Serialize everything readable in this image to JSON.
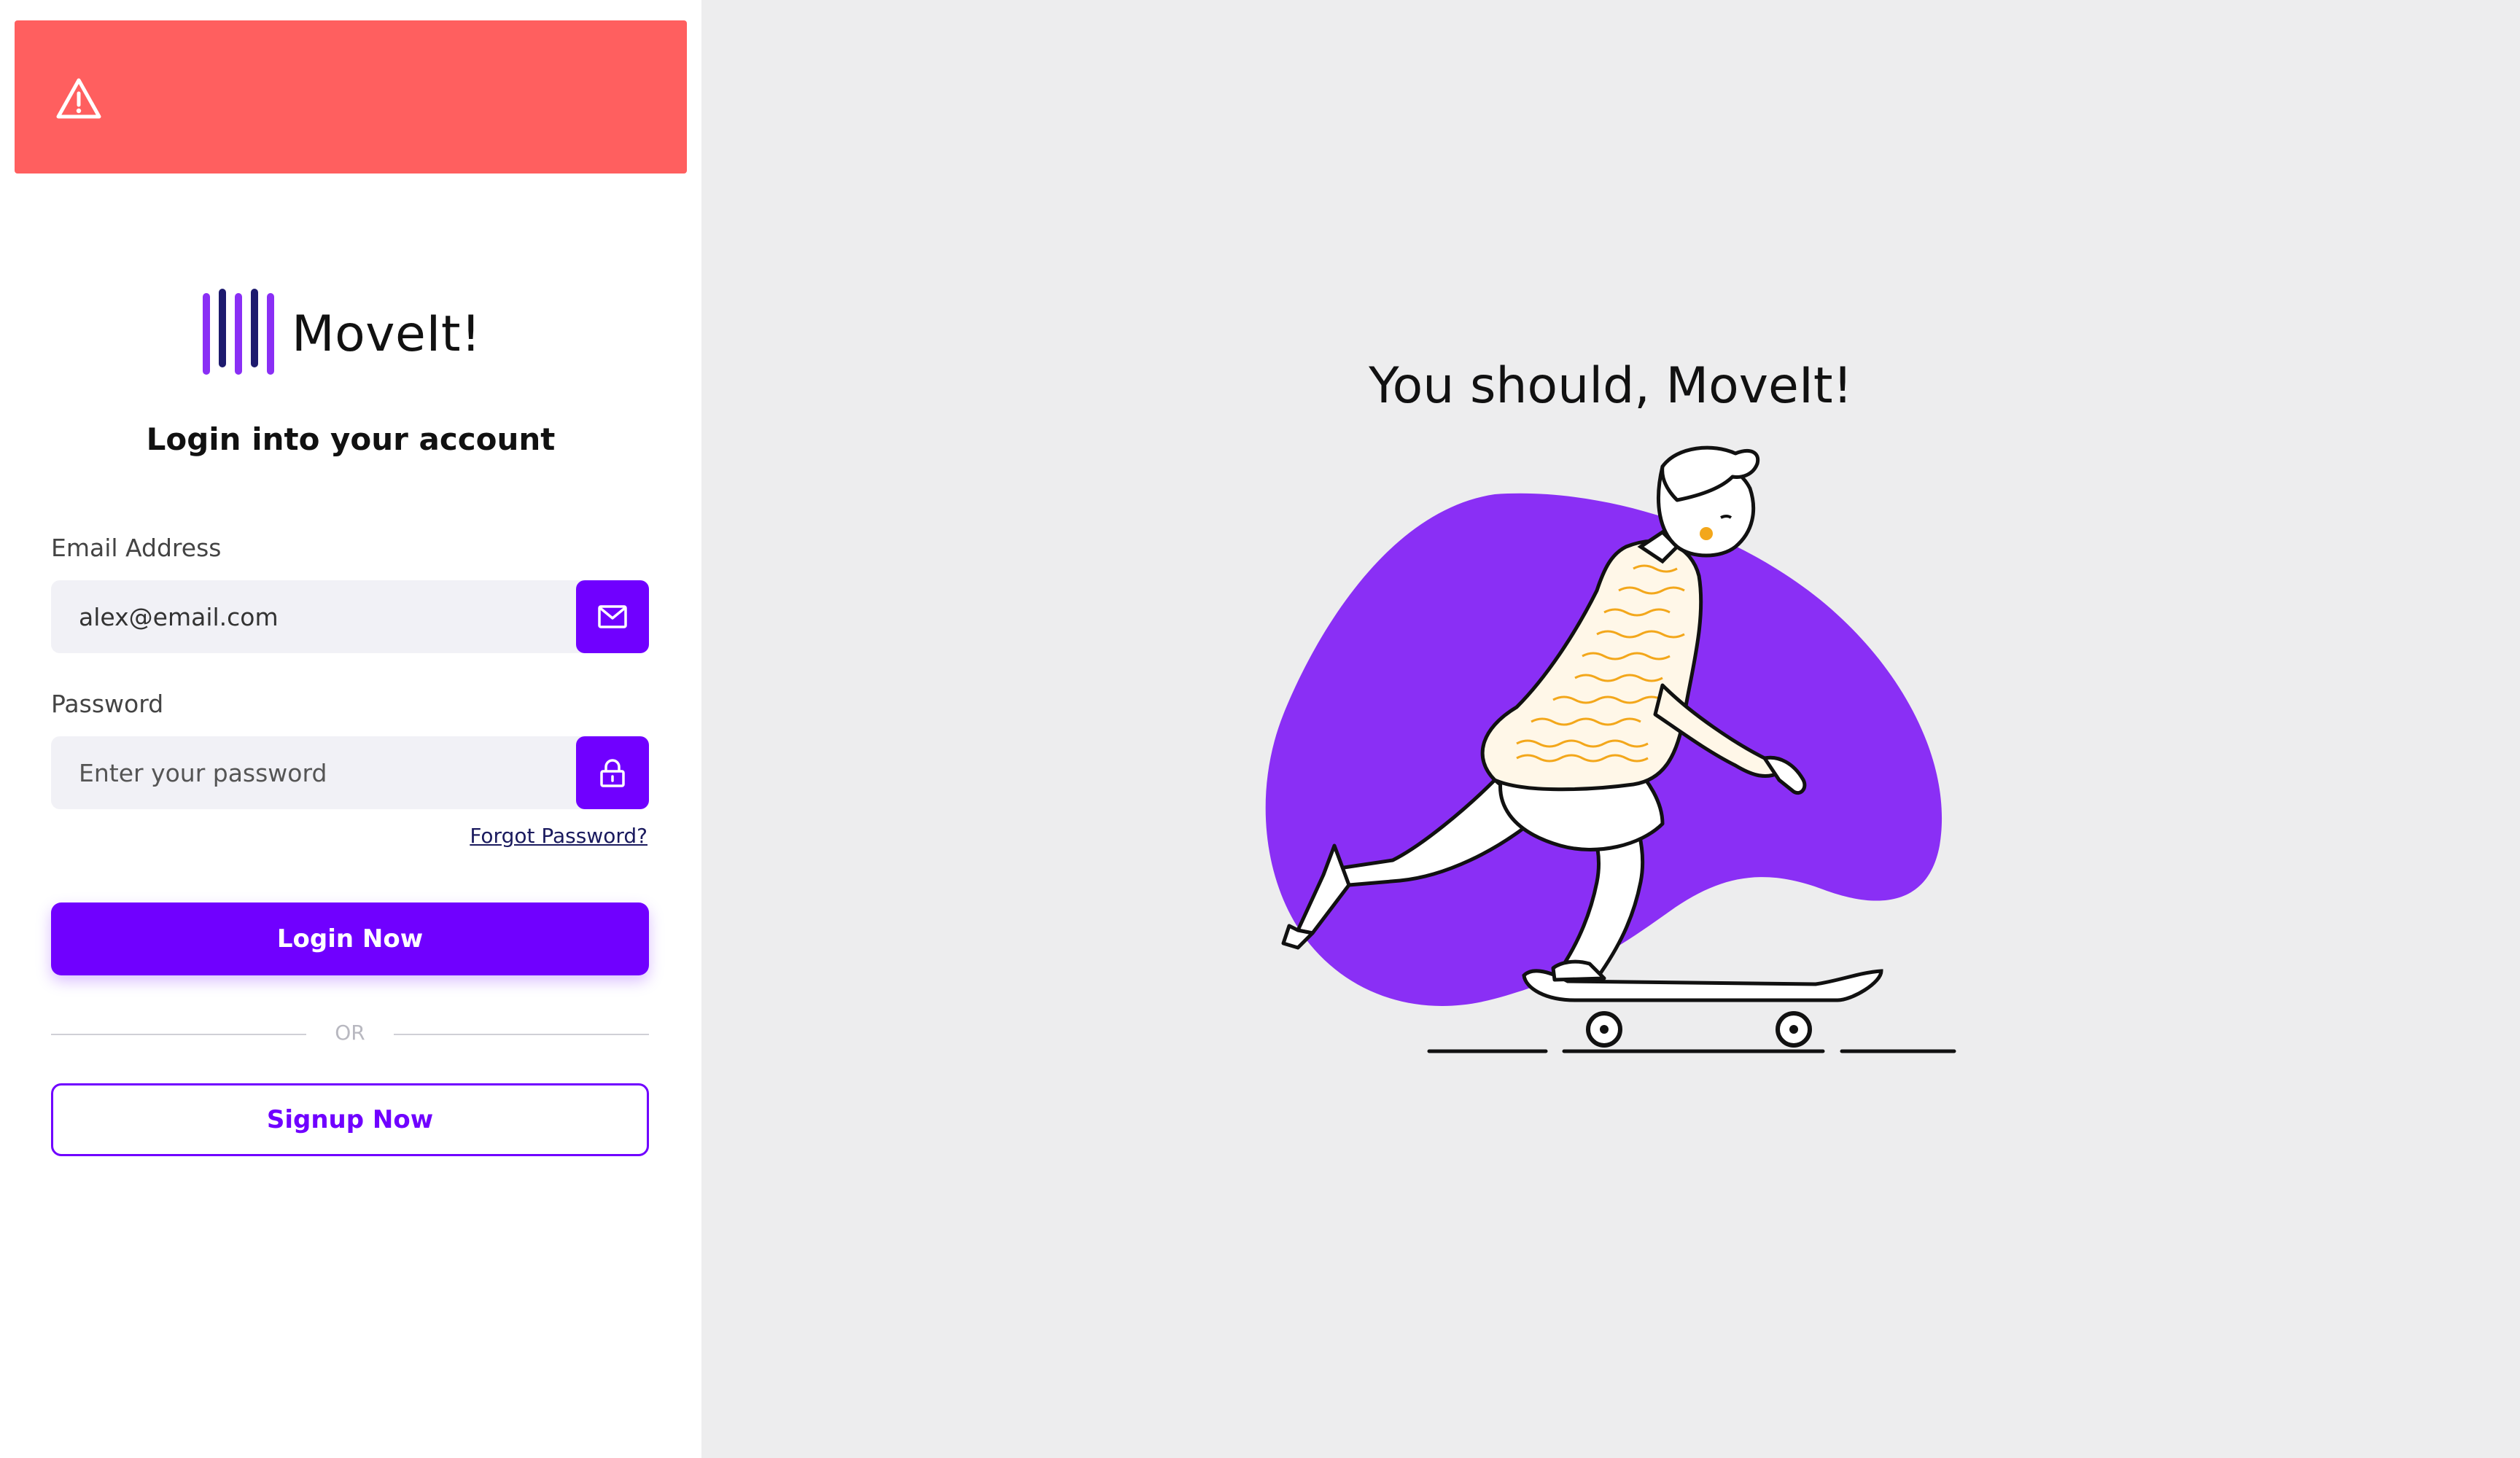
{
  "alert": {
    "icon": "warning-icon",
    "color": "#ff5f5f"
  },
  "brand": {
    "name": "MoveIt!",
    "accent": "#7000ff"
  },
  "login": {
    "heading": "Login into your account",
    "email": {
      "label": "Email Address",
      "value": "alex@email.com",
      "icon": "mail-icon"
    },
    "password": {
      "label": "Password",
      "placeholder": "Enter your password",
      "icon": "lock-icon"
    },
    "forgot_label": "Forgot Password?",
    "login_label": "Login Now",
    "divider_label": "OR",
    "signup_label": "Signup Now"
  },
  "hero": {
    "tagline": "You should, MoveIt!",
    "illustration": "skateboarder-illustration",
    "blob_color": "#8a2ff5"
  }
}
